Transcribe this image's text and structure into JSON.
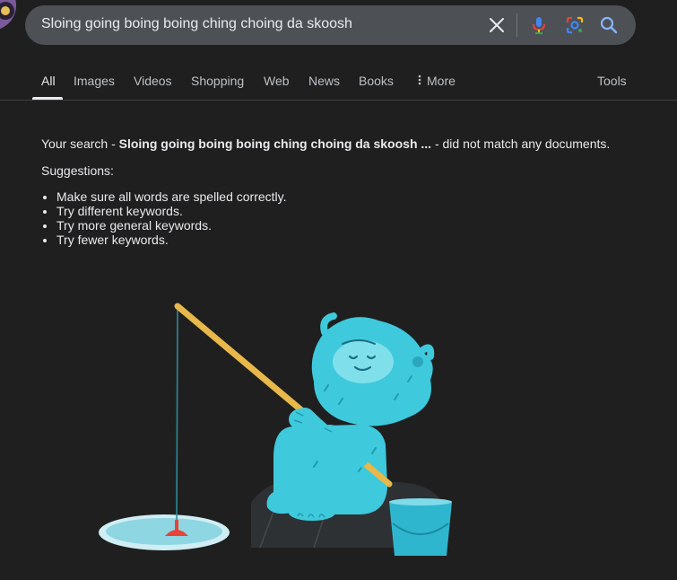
{
  "search": {
    "query": "Sloing going boing boing ching choing da skoosh"
  },
  "tabs": [
    {
      "label": "All",
      "active": true
    },
    {
      "label": "Images"
    },
    {
      "label": "Videos"
    },
    {
      "label": "Shopping"
    },
    {
      "label": "Web"
    },
    {
      "label": "News"
    },
    {
      "label": "Books"
    },
    {
      "label": "More"
    }
  ],
  "tools_label": "Tools",
  "result": {
    "prefix": "Your search - ",
    "query_bold": "Sloing going boing boing ching choing da skoosh ...",
    "suffix": " - did not match any documents."
  },
  "suggestions": {
    "title": "Suggestions:",
    "items": [
      "Make sure all words are spelled correctly.",
      "Try different keywords.",
      "Try more general keywords.",
      "Try fewer keywords."
    ]
  },
  "colors": {
    "background": "#1f1f1f",
    "searchbar": "#4d5156",
    "yeti": "#3ec9dc",
    "rod": "#e8b84a",
    "bobber": "#ea4335"
  },
  "icons": [
    "clear-icon",
    "mic-icon",
    "lens-icon",
    "search-icon",
    "more-dots-icon"
  ]
}
